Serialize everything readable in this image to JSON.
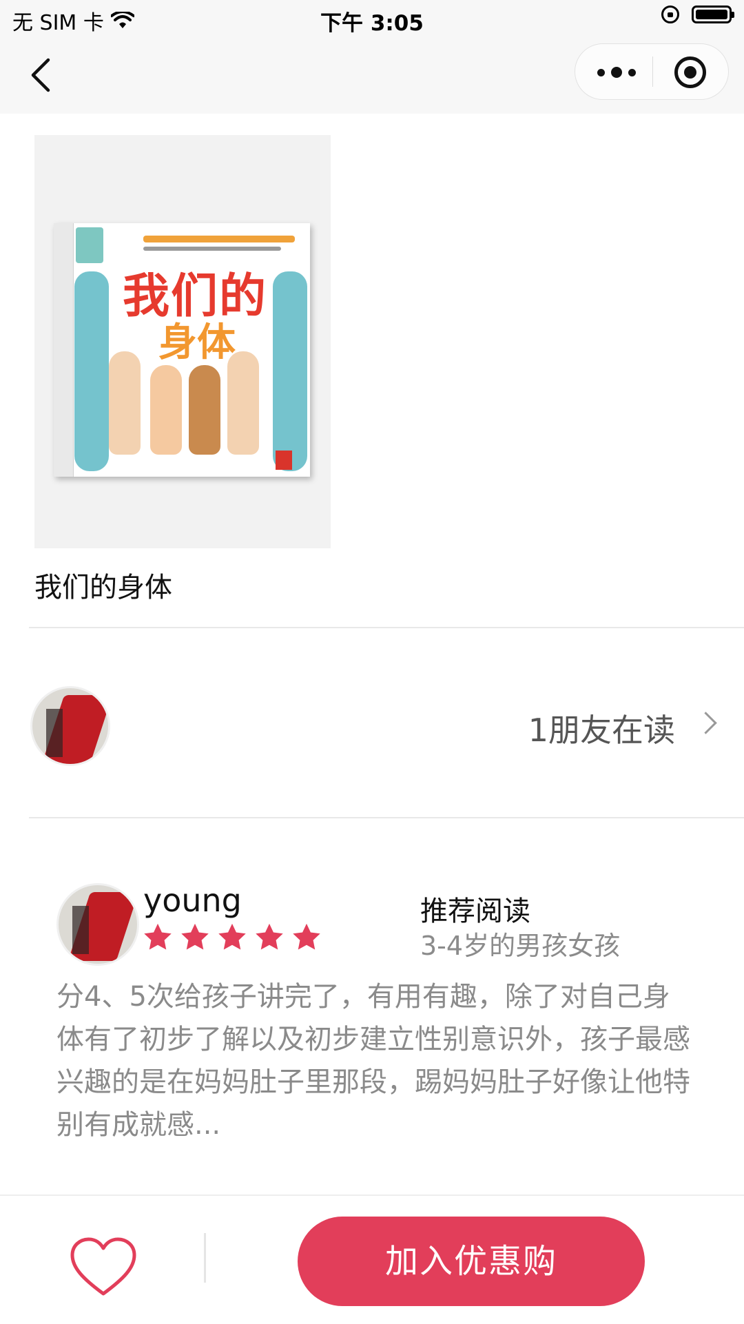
{
  "status_bar": {
    "carrier": "无 SIM 卡",
    "time": "下午 3:05"
  },
  "nav": {
    "back_icon": "chevron-left-icon",
    "more_icon": "more-dots-icon",
    "close_icon": "target-circle-icon"
  },
  "book": {
    "title": "我们的身体",
    "cover_title_line1": "我们的",
    "cover_title_line2": "身体"
  },
  "friends": {
    "reading_text": "1朋友在读"
  },
  "review": {
    "reviewer_name": "young",
    "rating": 5,
    "max_rating": 5,
    "recommend_label": "推荐阅读",
    "recommend_age": "3-4岁的男孩女孩",
    "text": "分4、5次给孩子讲完了，有用有趣，除了对自己身体有了初步了解以及初步建立性别意识外，孩子最感兴趣的是在妈妈肚子里那段，踢妈妈肚子好像让他特别有成就感..."
  },
  "bottom": {
    "favorite_icon": "heart-icon",
    "buy_label": "加入优惠购"
  },
  "colors": {
    "accent": "#e23e5a",
    "star": "#e23e5a",
    "muted_text": "#8a8a8a"
  }
}
